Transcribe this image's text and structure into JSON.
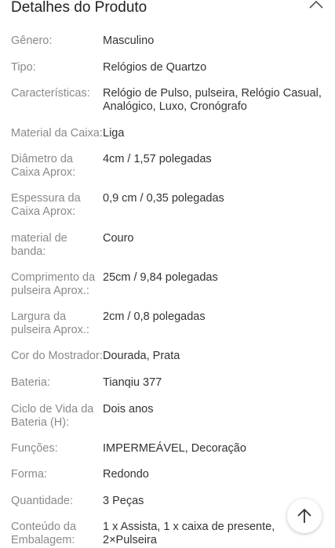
{
  "header": {
    "title": "Detalhes do Produto",
    "collapse_icon": "chevron-up-icon"
  },
  "specs": [
    {
      "label": "Gênero:",
      "value": "Masculino"
    },
    {
      "label": "Tipo:",
      "value": "Relógios de Quartzo"
    },
    {
      "label": "Características:",
      "value": "Relógio de Pulso, pulseira, Relógio Casual, Analógico, Luxo, Cronógrafo"
    },
    {
      "label": "Material da Caixa:",
      "value": "Liga"
    },
    {
      "label": "Diâmetro da Caixa Aprox:",
      "value": "4cm / 1,57 polegadas"
    },
    {
      "label": "Espessura da Caixa Aprox:",
      "value": "0,9 cm / 0,35 polegadas"
    },
    {
      "label": "material de banda:",
      "value": "Couro"
    },
    {
      "label": "Comprimento da pulseira Aprox.:",
      "value": "25cm / 9,84 polegadas"
    },
    {
      "label": "Largura da pulseira Aprox.:",
      "value": "2cm / 0,8 polegadas"
    },
    {
      "label": "Cor do Mostrador:",
      "value": "Dourada, Prata"
    },
    {
      "label": "Bateria:",
      "value": "Tianqiu 377"
    },
    {
      "label": "Ciclo de Vida da Bateria (H):",
      "value": "Dois anos"
    },
    {
      "label": "Funções:",
      "value": "IMPERMEÁVEL, Decoração"
    },
    {
      "label": "Forma:",
      "value": "Redondo"
    },
    {
      "label": "Quantidade:",
      "value": "3 Peças"
    },
    {
      "label": "Conteúdo da Embalagem:",
      "value": "1 x Assista, 1 x caixa de presente, 2×Pulseira"
    }
  ],
  "scroll_top": {
    "icon": "arrow-up-icon"
  }
}
